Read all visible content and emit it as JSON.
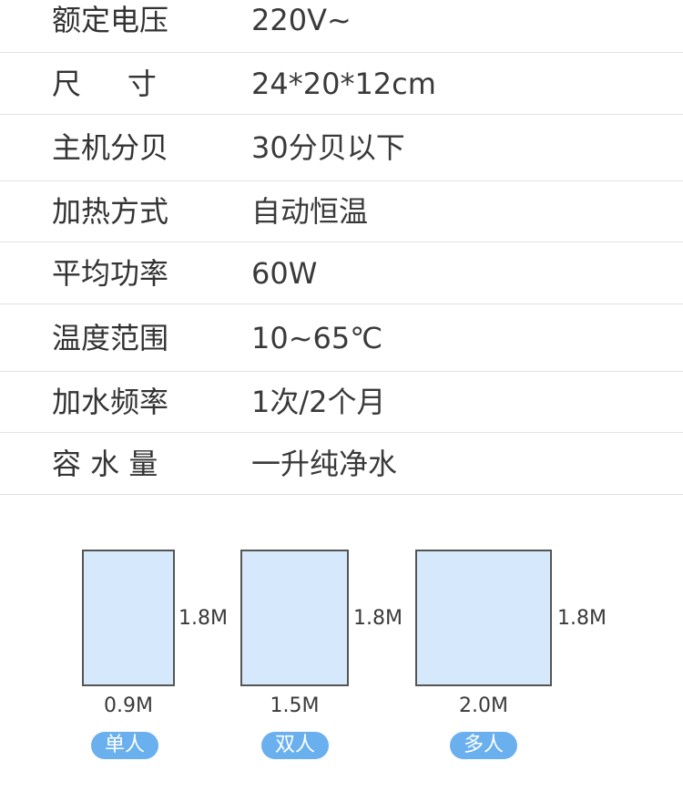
{
  "specs": [
    {
      "label": "额定电压",
      "value": "220V~"
    },
    {
      "label": "尺     寸",
      "value": "24*20*12cm"
    },
    {
      "label": "主机分贝",
      "value": "30分贝以下"
    },
    {
      "label": "加热方式",
      "value": "自动恒温"
    },
    {
      "label": "平均功率",
      "value": "60W"
    },
    {
      "label": "温度范围",
      "value": "10~65℃"
    },
    {
      "label": "加水频率",
      "value": "1次/2个月"
    },
    {
      "label": "容 水 量",
      "value": "一升纯净水"
    }
  ],
  "beds": [
    {
      "width": "0.9M",
      "height": "1.8M",
      "tag": "单人"
    },
    {
      "width": "1.5M",
      "height": "1.8M",
      "tag": "双人"
    },
    {
      "width": "2.0M",
      "height": "1.8M",
      "tag": "多人"
    }
  ],
  "colors": {
    "bed_fill": "#d6e8fb",
    "pill": "#6ab0ee",
    "divider": "#e2e2e2"
  }
}
